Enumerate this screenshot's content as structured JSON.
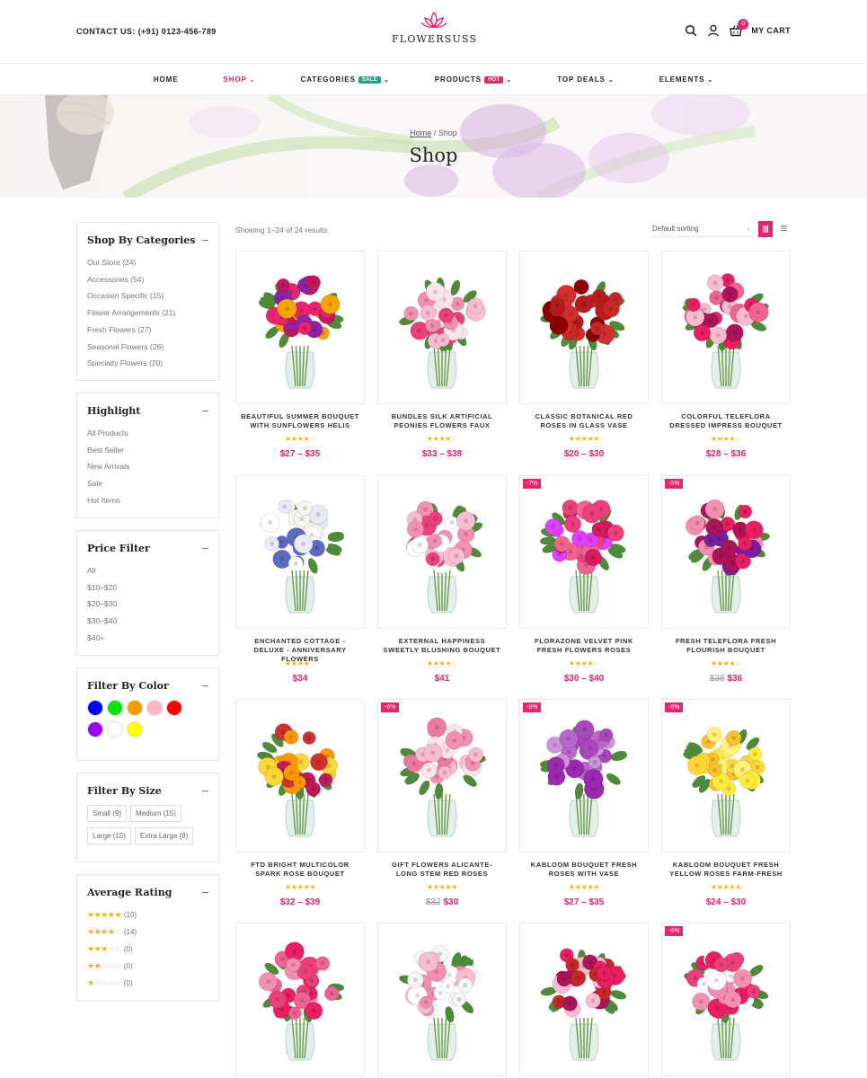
{
  "header": {
    "contact": "CONTACT US: (+91) 0123-456-789",
    "logo_text": "FLOWERSUSS",
    "cart_count": "0",
    "cart_label": "MY CART"
  },
  "nav": [
    {
      "label": "HOME",
      "caret": false,
      "active": false
    },
    {
      "label": "SHOP",
      "caret": true,
      "active": true
    },
    {
      "label": "CATEGORIES",
      "caret": true,
      "active": false,
      "badge": "SALE",
      "badge_color": "#1aa887"
    },
    {
      "label": "PRODUCTS",
      "caret": true,
      "active": false,
      "badge": "HOT",
      "badge_color": "#e8246e"
    },
    {
      "label": "TOP DEALS",
      "caret": true,
      "active": false
    },
    {
      "label": "ELEMENTS",
      "caret": true,
      "active": false
    }
  ],
  "hero": {
    "breadcrumb_home": "Home",
    "breadcrumb_sep": "/",
    "breadcrumb_current": "Shop",
    "title": "Shop"
  },
  "sidebar": {
    "categories": {
      "title": "Shop By Categories",
      "items": [
        "Our Store (24)",
        "Accessories (54)",
        "Occasion Specific (15)",
        "Flower Arrangements (21)",
        "Fresh Flowers (27)",
        "Seasonal Flowers (26)",
        "Specialty Flowers (20)"
      ]
    },
    "highlight": {
      "title": "Highlight",
      "items": [
        "All Products",
        "Best Seller",
        "New Arrivals",
        "Sale",
        "Hot Items"
      ]
    },
    "price": {
      "title": "Price Filter",
      "items": [
        "All",
        "$10–$20",
        "$20–$30",
        "$30–$40",
        "$40+"
      ]
    },
    "color": {
      "title": "Filter By Color",
      "swatches": [
        "#0000ff",
        "#00e600",
        "#ff9900",
        "#ffb6c1",
        "#ff0000",
        "#9900ff",
        "#ffffff",
        "#ffff00"
      ]
    },
    "size": {
      "title": "Filter By Size",
      "items": [
        "Small (9)",
        "Medium (15)",
        "Large (15)",
        "Extra Large (8)"
      ]
    },
    "rating": {
      "title": "Average Rating",
      "items": [
        {
          "stars": 5,
          "count": "(10)"
        },
        {
          "stars": 4,
          "count": "(14)"
        },
        {
          "stars": 3,
          "count": "(0)"
        },
        {
          "stars": 2,
          "count": "(0)"
        },
        {
          "stars": 1,
          "count": "(0)"
        }
      ]
    }
  },
  "shop": {
    "result_count": "Showing 1–24 of 24 results",
    "sort_label": "Default sorting"
  },
  "products": [
    {
      "name": "BEAUTIFUL SUMMER BOUQUET WITH SUNFLOWERS HELIS",
      "rating": 4,
      "price": "$27 – $35",
      "old_price": "",
      "badge": "",
      "colors": [
        "#f5a300",
        "#e8246e",
        "#c2185b",
        "#8e24aa"
      ]
    },
    {
      "name": "BUNDLES SILK ARTIFICIAL PEONIES FLOWERS FAUX",
      "rating": 4,
      "price": "$33 – $38",
      "old_price": "",
      "badge": "",
      "colors": [
        "#f48fb1",
        "#f8bbd0",
        "#ec407a",
        "#fce4ec"
      ]
    },
    {
      "name": "CLASSIC BOTANICAL RED ROSES IN GLASS VASE",
      "rating": 5,
      "price": "$20 – $30",
      "old_price": "",
      "badge": "",
      "colors": [
        "#c62828",
        "#b71c1c",
        "#d32f2f",
        "#8e0000"
      ]
    },
    {
      "name": "COLORFUL TELEFLORA DRESSED IMPRESS BOUQUET",
      "rating": 4,
      "price": "$28 – $36",
      "old_price": "",
      "badge": "",
      "colors": [
        "#e91e63",
        "#f06292",
        "#ad1457",
        "#f8bbd0"
      ]
    },
    {
      "name": "ENCHANTED COTTAGE - DELUXE - ANNIVERSARY FLOWERS",
      "rating": 4,
      "price": "$34",
      "old_price": "",
      "badge": "",
      "colors": [
        "#f5f5f0",
        "#ffffff",
        "#5c6bc0",
        "#e8eaf6"
      ]
    },
    {
      "name": "EXTERNAL HAPPINESS SWEETLY BLUSHING BOUQUET",
      "rating": 4,
      "price": "$41",
      "old_price": "",
      "badge": "",
      "colors": [
        "#f8bbd0",
        "#f48fb1",
        "#ffffff",
        "#ec407a"
      ]
    },
    {
      "name": "FLORAZONE VELVET PINK FRESH FLOWERS ROSES",
      "rating": 4,
      "price": "$30 – $40",
      "old_price": "",
      "badge": "-7%",
      "colors": [
        "#e040fb",
        "#ec407a",
        "#f06292",
        "#d81b60"
      ]
    },
    {
      "name": "FRESH TELEFLORA FRESH FLOURISH BOUQUET",
      "rating": 4,
      "price": "$36",
      "old_price": "$38",
      "badge": "-5%",
      "colors": [
        "#ad1457",
        "#e91e63",
        "#7b1fa2",
        "#f48fb1"
      ]
    },
    {
      "name": "FTD BRIGHT MULTICOLOR SPARK ROSE BOUQUET",
      "rating": 5,
      "price": "$32 – $39",
      "old_price": "",
      "badge": "",
      "colors": [
        "#d32f2f",
        "#ff9800",
        "#fdd835",
        "#c2185b"
      ]
    },
    {
      "name": "GIFT FLOWERS ALICANTE- LONG STEM RED ROSES",
      "rating": 5,
      "price": "$30",
      "old_price": "$32",
      "badge": "-6%",
      "colors": [
        "#f48fb1",
        "#f8bbd0",
        "#ec7aa0",
        "#fce4ec"
      ]
    },
    {
      "name": "KABLOOM BOUQUET FRESH ROSES WITH VASE",
      "rating": 5,
      "price": "$27 – $35",
      "old_price": "",
      "badge": "-8%",
      "colors": [
        "#ba68c8",
        "#ab47bc",
        "#ce93d8",
        "#9c27b0"
      ]
    },
    {
      "name": "KABLOOM BOUQUET FRESH YELLOW ROSES FARM-FRESH",
      "rating": 5,
      "price": "$24 – $30",
      "old_price": "",
      "badge": "-6%",
      "colors": [
        "#fdd835",
        "#ffeb3b",
        "#fbc02d",
        "#fff176"
      ]
    },
    {
      "name": "",
      "rating": 0,
      "price": "",
      "old_price": "",
      "badge": "",
      "colors": [
        "#f06292",
        "#ec407a",
        "#f48fb1",
        "#e91e63"
      ]
    },
    {
      "name": "",
      "rating": 0,
      "price": "",
      "old_price": "",
      "badge": "",
      "colors": [
        "#ffffff",
        "#f8bbd0",
        "#f5f5f5",
        "#f48fb1"
      ]
    },
    {
      "name": "",
      "rating": 0,
      "price": "",
      "old_price": "",
      "badge": "",
      "colors": [
        "#c62828",
        "#e91e63",
        "#ad1457",
        "#f8bbd0"
      ]
    },
    {
      "name": "",
      "rating": 0,
      "price": "",
      "old_price": "",
      "badge": "-6%",
      "colors": [
        "#ec407a",
        "#f48fb1",
        "#ffffff",
        "#e91e63"
      ]
    }
  ]
}
